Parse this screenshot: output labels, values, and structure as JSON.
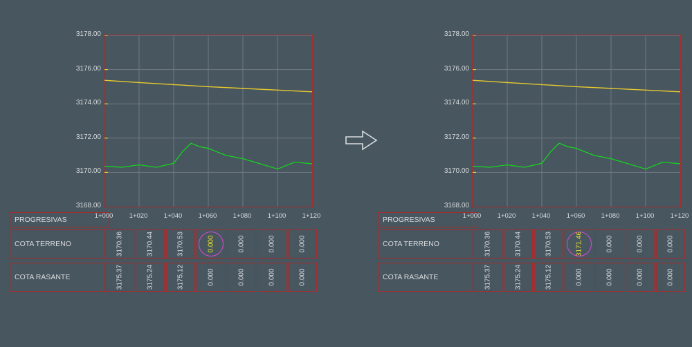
{
  "yaxis_labels": [
    "3178.00",
    "3176.00",
    "3174.00",
    "3172.00",
    "3170.00",
    "3168.00"
  ],
  "xaxis_labels": [
    "1+000",
    "1+020",
    "1+040",
    "1+060",
    "1+080",
    "1+100",
    "1+120"
  ],
  "rows": {
    "progresivas": "PROGRESIVAS",
    "terreno": "COTA TERRENO",
    "rasante": "COTA RASANTE"
  },
  "panel_left": {
    "terreno": [
      "3170.36",
      "3170.44",
      "3170.53",
      "0.000",
      "0.000",
      "0.000",
      "0.000"
    ],
    "rasante": [
      "3175.37",
      "3175.24",
      "3175.12",
      "0.000",
      "0.000",
      "0.000",
      "0.000"
    ],
    "highlight_index": 3
  },
  "panel_right": {
    "terreno": [
      "3170.36",
      "3170.44",
      "3170.53",
      "3171.46",
      "0.000",
      "0.000",
      "0.000"
    ],
    "rasante": [
      "3175.37",
      "3175.24",
      "3175.12",
      "0.000",
      "0.000",
      "0.000",
      "0.000"
    ],
    "highlight_index": 3
  },
  "chart_data": [
    {
      "type": "line",
      "title": "",
      "xlabel": "",
      "ylabel": "",
      "ylim": [
        3168,
        3178
      ],
      "x_ticks": [
        "1+000",
        "1+020",
        "1+040",
        "1+060",
        "1+080",
        "1+100",
        "1+120"
      ],
      "series": [
        {
          "name": "rasante",
          "color": "#e7ca2d",
          "x": [
            0,
            20,
            40,
            60,
            80,
            100,
            120
          ],
          "y": [
            3175.37,
            3175.24,
            3175.12,
            3175.0,
            3174.9,
            3174.8,
            3174.7
          ]
        },
        {
          "name": "terreno",
          "color": "#15d41e",
          "x": [
            0,
            10,
            20,
            30,
            40,
            45,
            50,
            55,
            60,
            65,
            70,
            80,
            90,
            100,
            110,
            120
          ],
          "y": [
            3170.36,
            3170.3,
            3170.44,
            3170.3,
            3170.53,
            3171.2,
            3171.7,
            3171.5,
            3171.4,
            3171.2,
            3171.0,
            3170.8,
            3170.5,
            3170.2,
            3170.6,
            3170.5
          ]
        }
      ],
      "tables": {
        "COTA TERRENO": [
          "3170.36",
          "3170.44",
          "3170.53",
          "0.000",
          "0.000",
          "0.000",
          "0.000"
        ],
        "COTA RASANTE": [
          "3175.37",
          "3175.24",
          "3175.12",
          "0.000",
          "0.000",
          "0.000",
          "0.000"
        ]
      }
    },
    {
      "type": "line",
      "title": "",
      "xlabel": "",
      "ylabel": "",
      "ylim": [
        3168,
        3178
      ],
      "x_ticks": [
        "1+000",
        "1+020",
        "1+040",
        "1+060",
        "1+080",
        "1+100",
        "1+120"
      ],
      "series": [
        {
          "name": "rasante",
          "color": "#e7ca2d",
          "x": [
            0,
            20,
            40,
            60,
            80,
            100,
            120
          ],
          "y": [
            3175.37,
            3175.24,
            3175.12,
            3175.0,
            3174.9,
            3174.8,
            3174.7
          ]
        },
        {
          "name": "terreno",
          "color": "#15d41e",
          "x": [
            0,
            10,
            20,
            30,
            40,
            45,
            50,
            55,
            60,
            65,
            70,
            80,
            90,
            100,
            110,
            120
          ],
          "y": [
            3170.36,
            3170.3,
            3170.44,
            3170.3,
            3170.53,
            3171.2,
            3171.7,
            3171.5,
            3171.4,
            3171.2,
            3171.0,
            3170.8,
            3170.5,
            3170.2,
            3170.6,
            3170.5
          ]
        }
      ],
      "tables": {
        "COTA TERRENO": [
          "3170.36",
          "3170.44",
          "3170.53",
          "3171.46",
          "0.000",
          "0.000",
          "0.000"
        ],
        "COTA RASANTE": [
          "3175.37",
          "3175.24",
          "3175.12",
          "0.000",
          "0.000",
          "0.000",
          "0.000"
        ]
      }
    }
  ]
}
